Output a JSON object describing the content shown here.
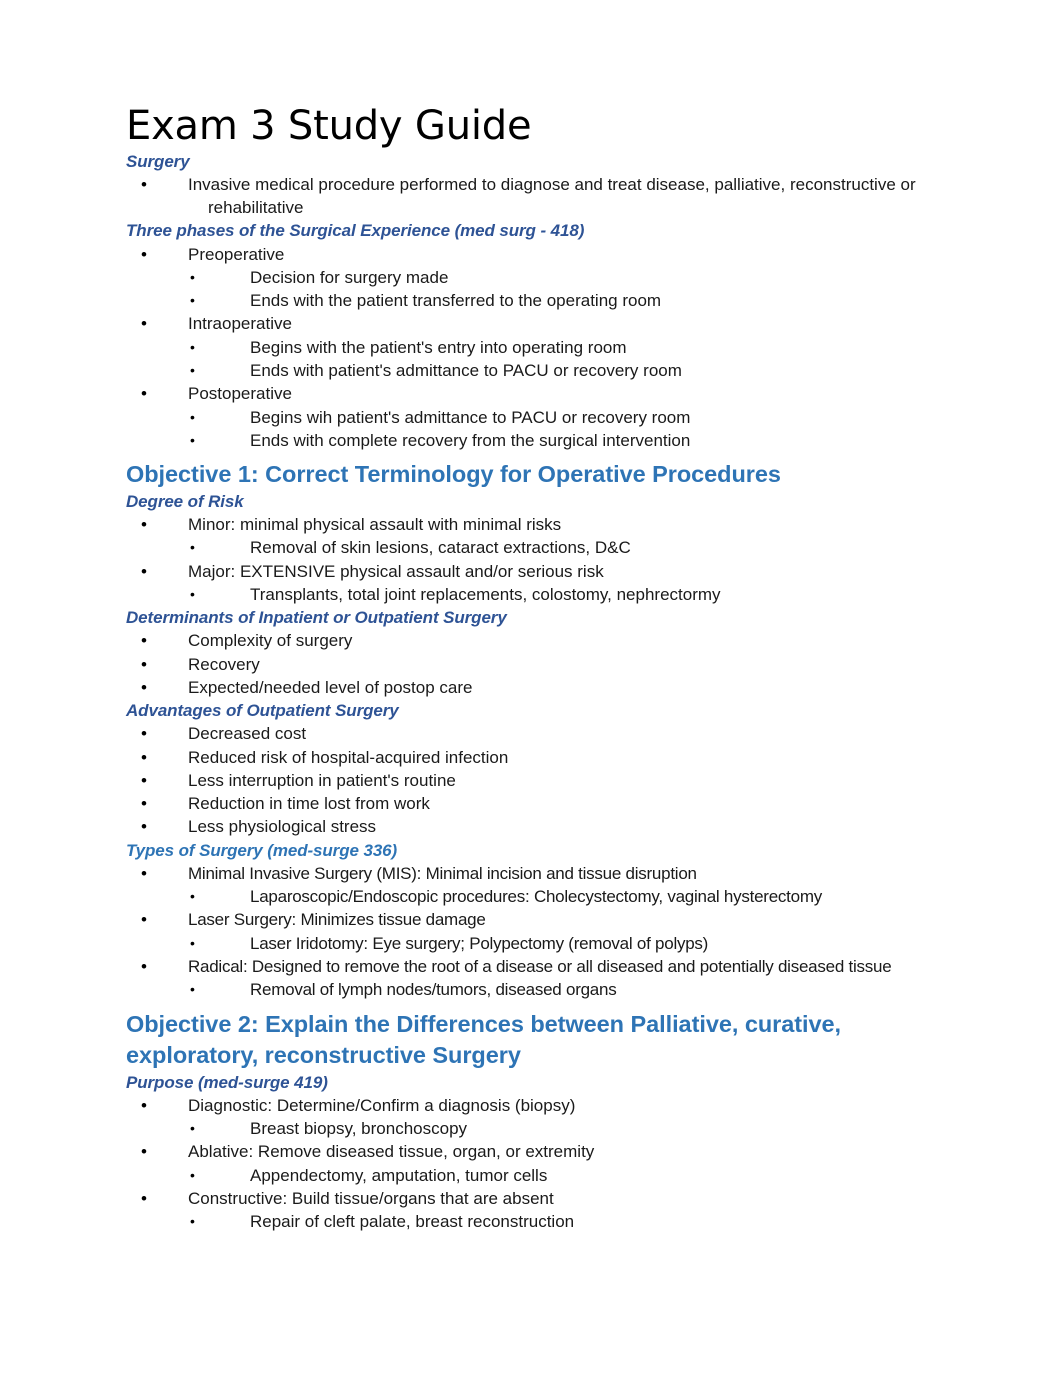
{
  "document": {
    "title": "Exam 3 Study Guide",
    "colors": {
      "heading1": "#2E74B5",
      "heading2": "#2E5395",
      "body": "#1a1a1a",
      "page_background": "#ffffff"
    }
  },
  "sections": [
    {
      "id": "surgery",
      "subhead": "Surgery",
      "items": [
        {
          "level": 1,
          "text": "Invasive medical procedure performed to diagnose and treat disease, palliative, reconstructive or rehabilitative"
        }
      ]
    },
    {
      "id": "three-phases",
      "subhead": "Three phases of the Surgical Experience (med surg - 418)",
      "items": [
        {
          "level": 1,
          "text": "Preoperative"
        },
        {
          "level": 2,
          "text": "Decision for surgery made"
        },
        {
          "level": 2,
          "text": "Ends with the patient transferred to the operating room"
        },
        {
          "level": 1,
          "text": "Intraoperative"
        },
        {
          "level": 2,
          "text": "Begins with the patient's entry into operating room"
        },
        {
          "level": 2,
          "text": "Ends with patient's admittance to PACU or recovery room"
        },
        {
          "level": 1,
          "text": "Postoperative"
        },
        {
          "level": 2,
          "text": "Begins wih patient's admittance to PACU or recovery room"
        },
        {
          "level": 2,
          "text": "Ends with complete recovery from the surgical intervention"
        }
      ]
    }
  ],
  "objective1": {
    "heading": "Objective 1: Correct Terminology for Operative Procedures",
    "sections": [
      {
        "id": "degree-of-risk",
        "subhead": "Degree of Risk",
        "items": [
          {
            "level": 1,
            "text": "Minor: minimal physical assault with minimal risks"
          },
          {
            "level": 2,
            "text": "Removal of skin lesions, cataract extractions, D&C"
          },
          {
            "level": 1,
            "text": "Major: EXTENSIVE physical assault and/or serious risk"
          },
          {
            "level": 2,
            "text": "Transplants, total joint replacements, colostomy, nephrectormy"
          }
        ]
      },
      {
        "id": "determinants",
        "subhead": "Determinants of Inpatient or Outpatient Surgery",
        "items": [
          {
            "level": 1,
            "text": "Complexity of surgery"
          },
          {
            "level": 1,
            "text": "Recovery"
          },
          {
            "level": 1,
            "text": "Expected/needed level of postop care"
          }
        ]
      },
      {
        "id": "advantages-outpatient",
        "subhead": "Advantages of Outpatient Surgery",
        "items": [
          {
            "level": 1,
            "text": "Decreased cost"
          },
          {
            "level": 1,
            "text": "Reduced risk of hospital-acquired infection"
          },
          {
            "level": 1,
            "text": "Less interruption in patient's routine"
          },
          {
            "level": 1,
            "text": "Reduction in time lost from work"
          },
          {
            "level": 1,
            "text": "Less physiological stress"
          }
        ]
      },
      {
        "id": "types-of-surgery",
        "subhead": "Types of Surgery (med-surge 336)",
        "narrow": true,
        "items": [
          {
            "level": 1,
            "text": "Minimal Invasive Surgery (MIS): Minimal incision and tissue disruption"
          },
          {
            "level": 2,
            "text": "Laparoscopic/Endoscopic procedures: Cholecystectomy, vaginal hysterectomy"
          },
          {
            "level": 1,
            "text": "Laser Surgery: Minimizes tissue damage"
          },
          {
            "level": 2,
            "text": "Laser Iridotomy: Eye surgery; Polypectomy (removal of polyps)"
          },
          {
            "level": 1,
            "text": "Radical: Designed to remove the root of a disease or all diseased and potentially diseased tissue"
          },
          {
            "level": 2,
            "text": "Removal of lymph nodes/tumors, diseased organs"
          }
        ]
      }
    ]
  },
  "objective2": {
    "heading": "Objective 2: Explain the Differences between Palliative, curative, exploratory, reconstructive Surgery",
    "sections": [
      {
        "id": "purpose",
        "subhead": "Purpose (med-surge 419)",
        "items": [
          {
            "level": 1,
            "text": "Diagnostic: Determine/Confirm a diagnosis (biopsy)"
          },
          {
            "level": 2,
            "text": "Breast biopsy, bronchoscopy"
          },
          {
            "level": 1,
            "text": "Ablative: Remove diseased tissue, organ, or extremity"
          },
          {
            "level": 2,
            "text": "Appendectomy, amputation, tumor cells"
          },
          {
            "level": 1,
            "text": "Constructive: Build tissue/organs that are absent"
          },
          {
            "level": 2,
            "text": "Repair of cleft palate, breast reconstruction"
          }
        ]
      }
    ]
  },
  "bullet_glyph": "•"
}
